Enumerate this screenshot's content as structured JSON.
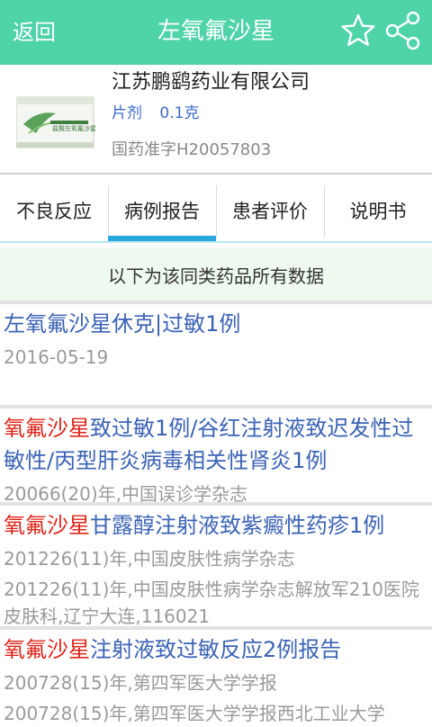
{
  "appbar": {
    "back_label": "返回",
    "title": "左氧氟沙星",
    "star_icon": "star-outline-icon",
    "share_icon": "share-icon"
  },
  "product": {
    "company": "江苏鹏鹞药业有限公司",
    "dosage_form": "片剂",
    "strength": "0.1克",
    "approval_no": "国药准字H20057803",
    "thumb_text": "盐酸左氧氟沙星片"
  },
  "tabs": [
    {
      "label": "不良反应",
      "active": false
    },
    {
      "label": "病例报告",
      "active": true
    },
    {
      "label": "患者评价",
      "active": false
    },
    {
      "label": "说明书",
      "active": false
    }
  ],
  "notice": "以下为该同类药品所有数据",
  "items": [
    {
      "highlight": "",
      "title": "左氧氟沙星休克|过敏1例",
      "meta": [
        "2016-05-19"
      ]
    },
    {
      "highlight": "氧氟沙星",
      "title": "致过敏1例/谷红注射液致迟发性过敏性/丙型肝炎病毒相关性肾炎1例",
      "meta": [
        "20066(20)年,中国误诊学杂志"
      ]
    },
    {
      "highlight": "氧氟沙星",
      "title": "甘露醇注射液致紫癜性药疹1例",
      "meta": [
        "201226(11)年,中国皮肤性病学杂志",
        "201226(11)年,中国皮肤性病学杂志解放军210医院皮肤科,辽宁大连,116021"
      ]
    },
    {
      "highlight": "氧氟沙星",
      "title": "注射液致过敏反应2例报告",
      "meta": [
        "200728(15)年,第四军医大学学报",
        "200728(15)年,第四军医大学学报西北工业大学"
      ]
    }
  ],
  "colors": {
    "appbar": "#4fd3a8",
    "link": "#3b63b5",
    "highlight": "#e0261a",
    "tab_indicator": "#29a8dd"
  }
}
